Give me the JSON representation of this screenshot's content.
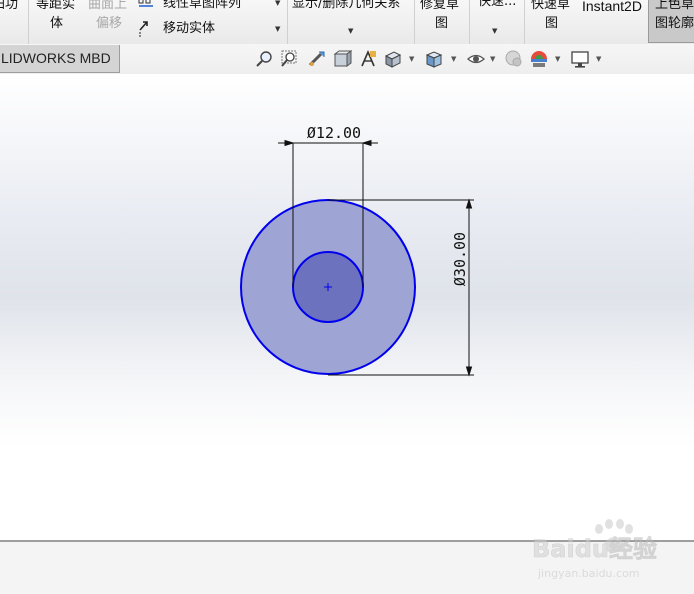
{
  "ribbon": {
    "items": [
      {
        "key": "partial_left",
        "label": "归功"
      },
      {
        "key": "offset_entities_line1",
        "label": "等距实"
      },
      {
        "key": "offset_entities_line2",
        "label": "体"
      },
      {
        "key": "offset_surface_line1",
        "label": "曲面上"
      },
      {
        "key": "offset_surface_line2",
        "label": "偏移"
      },
      {
        "key": "linear_pattern",
        "label": "线性草图阵列"
      },
      {
        "key": "move_entities",
        "label": "移动实体"
      },
      {
        "key": "display_relations",
        "label": "显示/删除几何关系"
      },
      {
        "key": "repair_sketch_line1",
        "label": "修复草"
      },
      {
        "key": "repair_sketch_line2",
        "label": "图"
      },
      {
        "key": "quick_snaps",
        "label": "快速..."
      },
      {
        "key": "rapid_sketch_line1",
        "label": "快速草"
      },
      {
        "key": "rapid_sketch_line2",
        "label": "图"
      },
      {
        "key": "instant2d",
        "label": "Instant2D"
      },
      {
        "key": "shaded_contours_line1",
        "label": "上色草"
      },
      {
        "key": "shaded_contours_line2",
        "label": "图轮廓"
      }
    ]
  },
  "tabs": {
    "active_label": "LIDWORKS MBD"
  },
  "view_toolbar": {
    "icons": [
      "zoom-to-fit-icon",
      "zoom-to-area-icon",
      "previous-view-icon",
      "section-view-icon",
      "dynamic-annotation-icon",
      "view-orientation-icon",
      "display-style-icon",
      "hide-show-items-icon",
      "edit-appearance-icon",
      "apply-scene-icon",
      "view-settings-icon"
    ]
  },
  "sketch": {
    "dim_small": "Ø12.00",
    "dim_large": "Ø30.00"
  },
  "watermark": {
    "brand": "Baidu经验",
    "url": "jingyan.baidu.com"
  },
  "colors": {
    "sketch_blue": "#0000ee",
    "fill_outer": "#9ea4d3",
    "fill_inner": "#6c72bd",
    "dimension": "#111111"
  }
}
